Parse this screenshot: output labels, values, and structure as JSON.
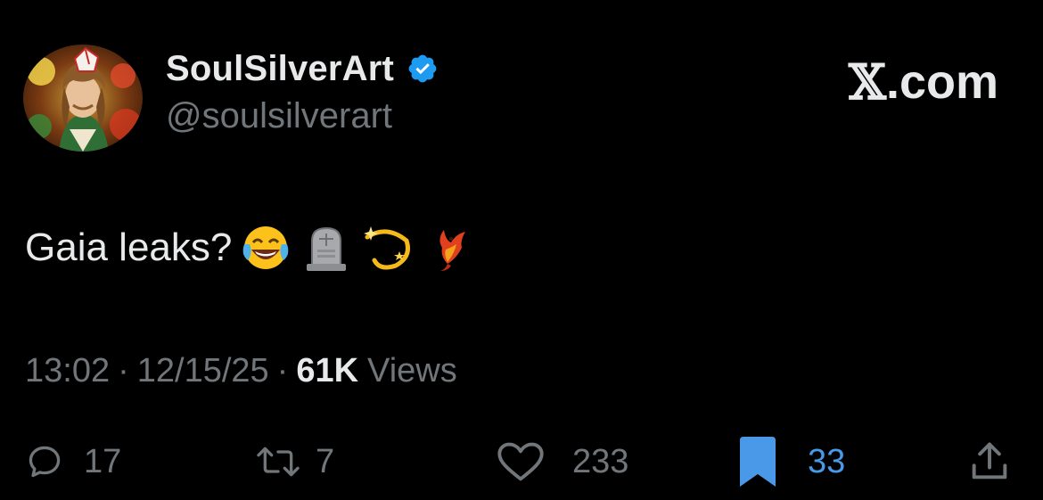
{
  "user": {
    "display_name": "SoulSilverArt",
    "handle": "@soulsilverart",
    "verified": true,
    "verified_color": "#1d9bf0"
  },
  "brand": {
    "x_glyph": "𝕏",
    "suffix": ".com"
  },
  "tweet": {
    "text": "Gaia leaks?",
    "emojis": [
      "face-with-tears-of-joy",
      "headstone",
      "dizzy-star",
      "phoenix"
    ]
  },
  "meta": {
    "time": "13:02",
    "separator": "·",
    "date": "12/15/25",
    "views_count": "61K",
    "views_label": "Views"
  },
  "actions": {
    "replies": "17",
    "reposts": "7",
    "likes": "233",
    "bookmarks": "33",
    "bookmark_active_color": "#4a99e9"
  }
}
